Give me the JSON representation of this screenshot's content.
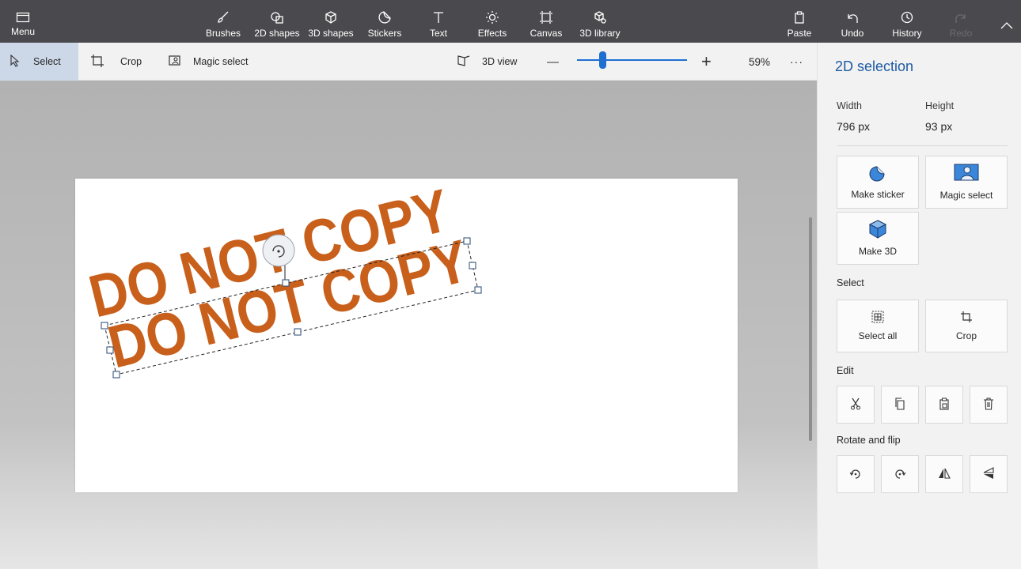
{
  "toolbar": {
    "menu": "Menu",
    "brushes": "Brushes",
    "shapes2d": "2D shapes",
    "shapes3d": "3D shapes",
    "stickers": "Stickers",
    "text": "Text",
    "effects": "Effects",
    "canvas": "Canvas",
    "library3d": "3D library",
    "paste": "Paste",
    "undo": "Undo",
    "history": "History",
    "redo": "Redo"
  },
  "subbar": {
    "select": "Select",
    "crop": "Crop",
    "magic_select": "Magic select",
    "view3d": "3D view",
    "zoom_minus": "—",
    "zoom_plus": "+",
    "zoom_level": "59%",
    "more": "···",
    "zoom_fraction": 0.23
  },
  "canvas": {
    "text_back": "DO NOT COPY",
    "text_front": "DO NOT COPY",
    "text_color": "#c8601c"
  },
  "panel": {
    "title": "2D selection",
    "width_label": "Width",
    "width_value": "796 px",
    "height_label": "Height",
    "height_value": "93 px",
    "make_sticker": "Make sticker",
    "magic_select": "Magic select",
    "make_3d": "Make 3D",
    "select_section": "Select",
    "select_all": "Select all",
    "crop": "Crop",
    "edit_section": "Edit",
    "rotate_section": "Rotate and flip"
  },
  "colors": {
    "accent": "#1e6fd0",
    "topbar": "#4a4a4e",
    "panel_title": "#1d5aa3"
  },
  "icons": [
    "menu-icon",
    "brush-icon",
    "shapes-2d-icon",
    "cube-icon",
    "sticker-icon",
    "text-icon",
    "effects-icon",
    "canvas-icon",
    "library-3d-icon",
    "paste-icon",
    "undo-icon",
    "history-icon",
    "redo-icon",
    "collapse-chevron-icon",
    "select-arrow-icon",
    "crop-icon",
    "magic-select-icon",
    "view-3d-icon",
    "cut-icon",
    "copy-icon",
    "paste-small-icon",
    "delete-icon",
    "rotate-left-icon",
    "rotate-right-icon",
    "flip-horizontal-icon",
    "flip-vertical-icon",
    "rotate-handle-icon"
  ]
}
